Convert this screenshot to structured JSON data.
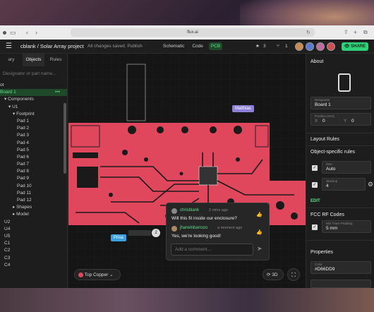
{
  "browser": {
    "url": "flux.ai"
  },
  "header": {
    "menu_icon": "hamburger-icon",
    "project_title": "cblank / Solar Array project",
    "save_status": "All changes saved. Publish",
    "views": [
      "Schematic",
      "Code",
      "PCB"
    ],
    "active_view": "PCB",
    "stars": "3",
    "forks": "1",
    "share_label": "SHARE"
  },
  "left_panel": {
    "tabs": [
      "ary",
      "Objects",
      "Rules"
    ],
    "search_placeholder": "Designator or part name...",
    "tree": [
      {
        "label": "ot",
        "indent": 0
      },
      {
        "label": "Board 1",
        "indent": 0,
        "selected": true
      },
      {
        "label": "Components",
        "indent": 1,
        "caret": "▾"
      },
      {
        "label": "U1",
        "indent": 2,
        "caret": "▾"
      },
      {
        "label": "Footprint",
        "indent": 3,
        "caret": "▾"
      },
      {
        "label": "Pad 1",
        "indent": 4
      },
      {
        "label": "Pad 2",
        "indent": 4
      },
      {
        "label": "Pad 3",
        "indent": 4
      },
      {
        "label": "Pad 4",
        "indent": 4
      },
      {
        "label": "Pad 5",
        "indent": 4
      },
      {
        "label": "Pad 6",
        "indent": 4
      },
      {
        "label": "Pad 7",
        "indent": 4
      },
      {
        "label": "Pad 8",
        "indent": 4
      },
      {
        "label": "Pad 9",
        "indent": 4
      },
      {
        "label": "Pad 10",
        "indent": 4
      },
      {
        "label": "Pad 11",
        "indent": 4
      },
      {
        "label": "Pad 12",
        "indent": 4
      },
      {
        "label": "Shapes",
        "indent": 3,
        "caret": "▸"
      },
      {
        "label": "Model",
        "indent": 3,
        "caret": "▸"
      },
      {
        "label": "U2",
        "indent": 1
      },
      {
        "label": "U4",
        "indent": 1
      },
      {
        "label": "U5",
        "indent": 1
      },
      {
        "label": "C1",
        "indent": 1
      },
      {
        "label": "C2",
        "indent": 1
      },
      {
        "label": "C3",
        "indent": 1
      },
      {
        "label": "C4",
        "indent": 1
      }
    ]
  },
  "canvas": {
    "board_color": "#D66DD9",
    "cursors": [
      {
        "name": "Matthias",
        "color": "#8e7fd8"
      },
      {
        "name": "Prisa",
        "color": "#3aa0e0"
      }
    ],
    "layer_selector": "Top Copper",
    "view_3d_label": "3D",
    "comment_pin": "2",
    "comments": [
      {
        "author": "chrisblank",
        "time": "2 mins ago",
        "text": "Will this fit inside our enclosure?"
      },
      {
        "author": "jharwinbarrozo",
        "time": "a moment ago",
        "text": "Yes, we're looking good!"
      }
    ],
    "comment_placeholder": "Add a comment..."
  },
  "right_panel": {
    "about_title": "About",
    "designator_label": "Designator",
    "designator_value": "Board 1",
    "position_label": "Position (mm)",
    "pos_x_label": "X",
    "pos_x": "0",
    "pos_y_label": "Y",
    "pos_y": "0",
    "layout_rules_title": "Layout Rules",
    "object_rules_title": "Object-specific rules",
    "size_label": "Size",
    "size_value": "Auto",
    "stackup_label": "Stackup",
    "stackup_value": "4",
    "edit_label": "EDIT",
    "fcc_title": "FCC RF Codes",
    "trace_label": "Min Trace Padding",
    "trace_value": "5 mm",
    "properties_title": "Properties",
    "color_label": "Color",
    "color_value": "#D66DD9"
  }
}
